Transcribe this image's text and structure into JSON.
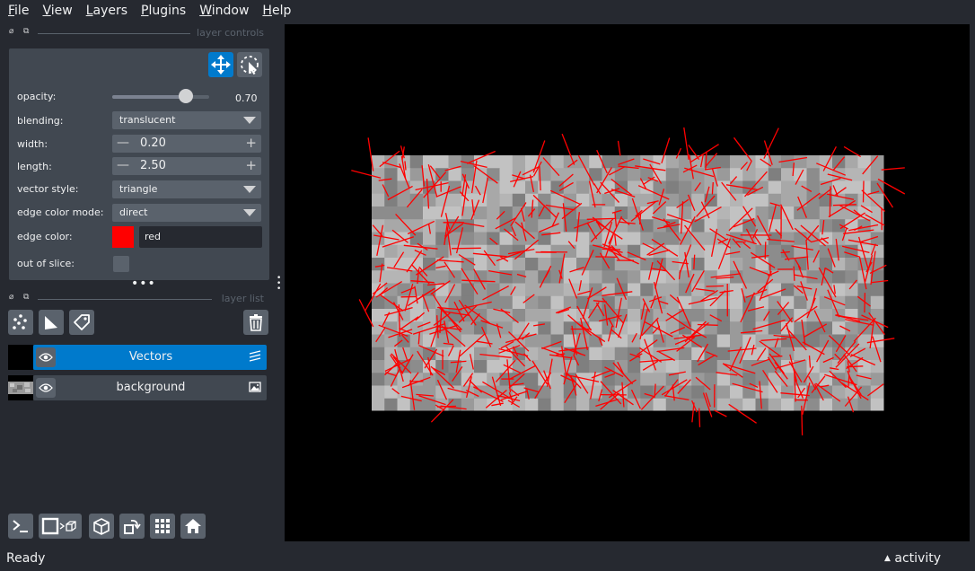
{
  "menubar": {
    "items": [
      {
        "mnemonic": "F",
        "rest": "ile"
      },
      {
        "mnemonic": "V",
        "rest": "iew"
      },
      {
        "mnemonic": "L",
        "rest": "ayers"
      },
      {
        "mnemonic": "P",
        "rest": "lugins"
      },
      {
        "mnemonic": "W",
        "rest": "indow"
      },
      {
        "mnemonic": "H",
        "rest": "elp"
      }
    ]
  },
  "layer_controls": {
    "title": "layer controls",
    "opacity_label": "opacity:",
    "opacity_value": 0.7,
    "opacity_text": "0.70",
    "blending_label": "blending:",
    "blending_value": "translucent",
    "width_label": "width:",
    "width_value": "0.20",
    "length_label": "length:",
    "length_value": "2.50",
    "vector_style_label": "vector style:",
    "vector_style_value": "triangle",
    "edge_color_mode_label": "edge color mode:",
    "edge_color_mode_value": "direct",
    "edge_color_label": "edge color:",
    "edge_color_value": "red",
    "edge_color_hex": "#ff0000",
    "out_of_slice_label": "out of slice:",
    "out_of_slice_checked": false
  },
  "layer_list": {
    "title": "layer list",
    "layers": [
      {
        "name": "Vectors",
        "selected": true,
        "visible": true,
        "icon": "vectors-icon"
      },
      {
        "name": "background",
        "selected": false,
        "visible": true,
        "icon": "image-icon"
      }
    ]
  },
  "colors": {
    "accent": "#007acc",
    "panel": "#414851",
    "background": "#262930",
    "button": "#5a626c"
  },
  "status": {
    "text": "Ready",
    "activity": "activity"
  }
}
